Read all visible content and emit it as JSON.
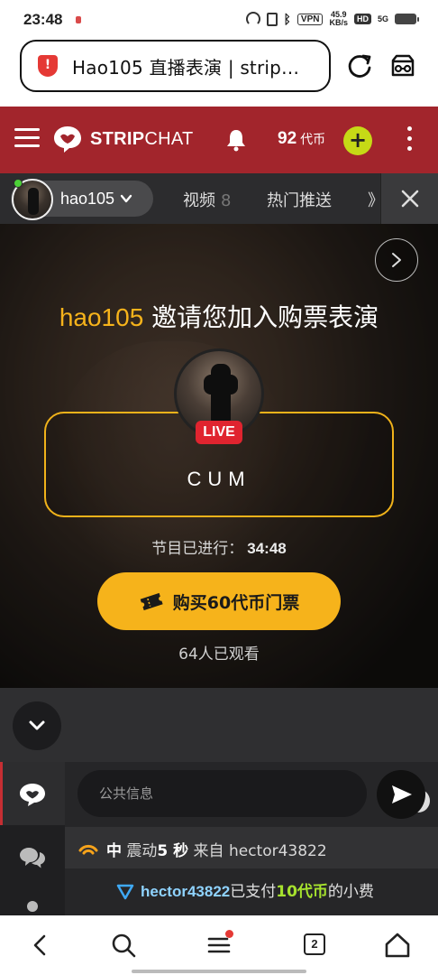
{
  "status_bar": {
    "time": "23:48",
    "vpn": "VPN",
    "speed_value": "45.9",
    "speed_unit": "KB/s",
    "hd": "HD",
    "network": "5G"
  },
  "browser": {
    "url_title": "Hao105 直播表演 | strip…",
    "tab_count": "2"
  },
  "header": {
    "logo_bold": "STRIP",
    "logo_light": "CHAT",
    "token_count": "92",
    "token_unit": "代币",
    "add_label": "+",
    "brand_color": "#a2252c"
  },
  "model_bar": {
    "model_name": "hao105",
    "tabs": [
      {
        "label": "视频",
        "count": "8"
      },
      {
        "label": "热门推送",
        "count": ""
      },
      {
        "label": "》",
        "count": ""
      }
    ]
  },
  "stage": {
    "invite_name": "hao105",
    "invite_text": " 邀请您加入购票表演",
    "live_badge": "LIVE",
    "show_title": "CUM",
    "elapsed_label": "节目已进行：",
    "elapsed_time": "34:48",
    "buy_label": "购买60代币门票",
    "viewers": "64人已观看",
    "accent_color": "#f6b31b"
  },
  "chat": {
    "input_placeholder": "公共信息",
    "messages": [
      {
        "level": "中",
        "action": " 震动",
        "duration": "5 秒",
        "from": " 来自 hector43822"
      },
      {
        "user": "hector43822",
        "text_a": "已支付",
        "amount": "10代币",
        "text_b": "的小费"
      }
    ]
  }
}
